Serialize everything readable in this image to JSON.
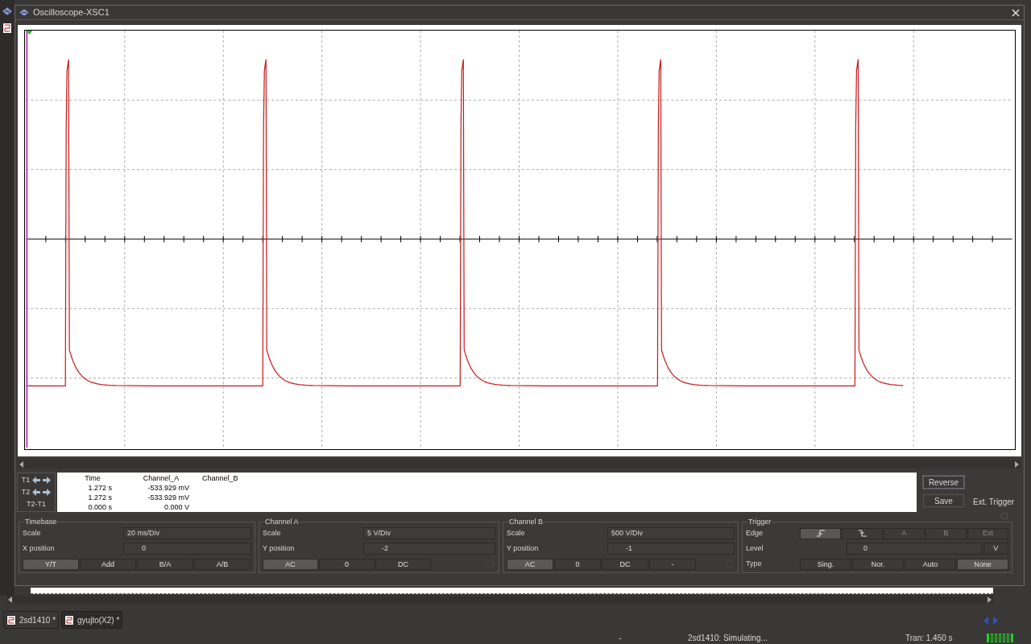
{
  "window": {
    "title": "Oscilloscope-XSC1"
  },
  "readout": {
    "cursors": [
      {
        "label": "T1",
        "arrows": true
      },
      {
        "label": "T2",
        "arrows": true
      },
      {
        "label": "T2-T1",
        "arrows": false
      }
    ],
    "columns": [
      "Time",
      "Channel_A",
      "Channel_B"
    ],
    "rows": [
      [
        "1.272 s",
        "-533.929 mV"
      ],
      [
        "1.272 s",
        "-533.929 mV"
      ],
      [
        "0.000 s",
        "0.000 V"
      ]
    ]
  },
  "side_buttons": [
    {
      "label": "Reverse",
      "focused": true
    },
    {
      "label": "Save",
      "focused": false
    }
  ],
  "ext_trigger": "Ext. Trigger",
  "timebase": {
    "title": "Timebase",
    "fields": [
      {
        "label": "Scale",
        "value": "20 ms/Div"
      },
      {
        "label": "X position",
        "value": "0"
      }
    ],
    "buttons": [
      {
        "label": "Y/T",
        "selected": true
      },
      {
        "label": "Add",
        "selected": false
      },
      {
        "label": "B/A",
        "selected": false
      },
      {
        "label": "A/B",
        "selected": false
      }
    ]
  },
  "channel_a": {
    "title": "Channel A",
    "fields": [
      {
        "label": "Scale",
        "value": "5  V/Div"
      },
      {
        "label": "Y position",
        "value": "-2"
      }
    ],
    "buttons": [
      {
        "label": "AC",
        "selected": true
      },
      {
        "label": "0",
        "selected": false
      },
      {
        "label": "DC",
        "selected": false
      }
    ]
  },
  "channel_b": {
    "title": "Channel B",
    "fields": [
      {
        "label": "Scale",
        "value": "500  V/Div"
      },
      {
        "label": "Y position",
        "value": "-1"
      }
    ],
    "buttons": [
      {
        "label": "AC",
        "selected": true
      },
      {
        "label": "0",
        "selected": false
      },
      {
        "label": "DC",
        "selected": false
      },
      {
        "label": "-",
        "selected": false
      }
    ]
  },
  "trigger": {
    "title": "Trigger",
    "edge_label": "Edge",
    "edges": [
      {
        "kind": "rising",
        "selected": true,
        "disabled": false
      },
      {
        "kind": "falling",
        "selected": false,
        "disabled": false
      },
      {
        "kind": "source",
        "label": "A",
        "selected": false,
        "disabled": true
      },
      {
        "kind": "source",
        "label": "B",
        "selected": false,
        "disabled": true
      },
      {
        "kind": "source",
        "label": "Ext",
        "selected": false,
        "disabled": true
      }
    ],
    "level_label": "Level",
    "level_value": "0",
    "level_unit": "V",
    "type_label": "Type",
    "types": [
      {
        "label": "Sing.",
        "selected": false
      },
      {
        "label": "Nor.",
        "selected": false
      },
      {
        "label": "Auto",
        "selected": false
      },
      {
        "label": "None",
        "selected": true
      }
    ]
  },
  "tabs": [
    {
      "label": "2sd1410 *",
      "selected": true
    },
    {
      "label": "gyujto(X2) *",
      "selected": false
    }
  ],
  "status_bar": [
    "-",
    "2sd1410: Simulating...",
    "Tran: 1.450 s"
  ]
}
